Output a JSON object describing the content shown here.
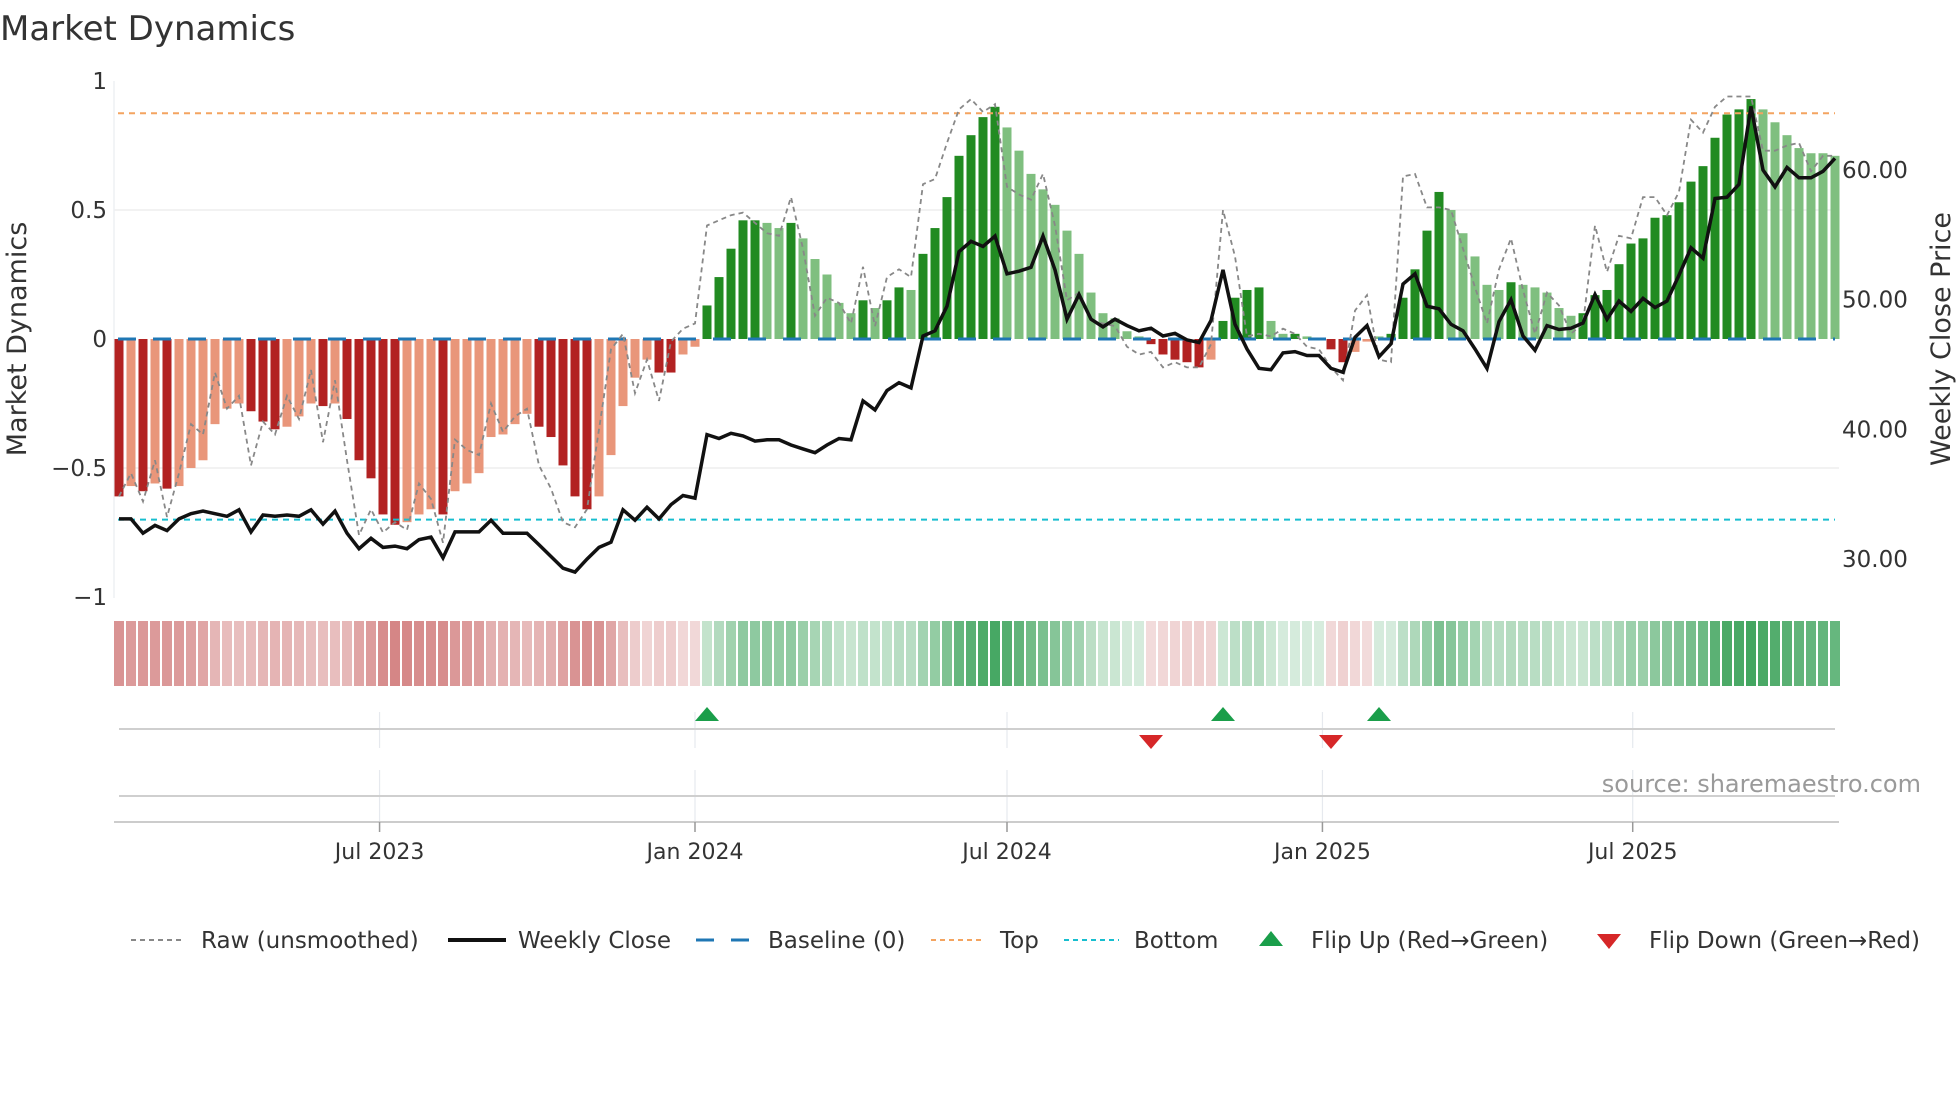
{
  "chart_data": {
    "type": "bar",
    "title": "Market Dynamics",
    "ylabel": "Market Dynamics",
    "y2label": "Weekly Close Price",
    "ylim": [
      -1,
      1
    ],
    "y2lim": [
      26,
      66
    ],
    "yticks": [
      {
        "value": 1,
        "label": "1"
      },
      {
        "value": 0.5,
        "label": "0.5"
      },
      {
        "value": 0,
        "label": "0"
      },
      {
        "value": -0.5,
        "label": "−0.5"
      },
      {
        "value": -1,
        "label": "−1"
      }
    ],
    "y2ticks": [
      {
        "value": 60,
        "label": "60.00"
      },
      {
        "value": 50,
        "label": "50.00"
      },
      {
        "value": 40,
        "label": "40.00"
      },
      {
        "value": 30,
        "label": "30.00"
      }
    ],
    "xticks": [
      {
        "date": "2023-07-01",
        "label": "Jul 2023"
      },
      {
        "date": "2024-01-01",
        "label": "Jan 2024"
      },
      {
        "date": "2024-07-01",
        "label": "Jul 2024"
      },
      {
        "date": "2025-01-01",
        "label": "Jan 2025"
      },
      {
        "date": "2025-07-01",
        "label": "Jul 2025"
      }
    ],
    "start_date": "2023-01-30",
    "frequency": "weekly",
    "grid": true,
    "legend_position": "bottom",
    "top_level": 0.875,
    "bottom_level": -0.7,
    "baseline": 0,
    "smoothed": [
      -0.61,
      -0.57,
      -0.59,
      -0.56,
      -0.58,
      -0.57,
      -0.5,
      -0.47,
      -0.33,
      -0.27,
      -0.25,
      -0.28,
      -0.32,
      -0.35,
      -0.34,
      -0.3,
      -0.25,
      -0.26,
      -0.25,
      -0.31,
      -0.47,
      -0.54,
      -0.68,
      -0.72,
      -0.71,
      -0.68,
      -0.66,
      -0.68,
      -0.59,
      -0.56,
      -0.52,
      -0.38,
      -0.37,
      -0.33,
      -0.29,
      -0.34,
      -0.38,
      -0.49,
      -0.61,
      -0.66,
      -0.61,
      -0.45,
      -0.26,
      -0.15,
      -0.08,
      -0.13,
      -0.13,
      -0.06,
      -0.03,
      0.13,
      0.24,
      0.35,
      0.46,
      0.46,
      0.45,
      0.43,
      0.45,
      0.39,
      0.31,
      0.25,
      0.14,
      0.1,
      0.15,
      0.12,
      0.15,
      0.2,
      0.19,
      0.33,
      0.43,
      0.55,
      0.71,
      0.79,
      0.86,
      0.9,
      0.82,
      0.73,
      0.64,
      0.58,
      0.52,
      0.42,
      0.33,
      0.18,
      0.1,
      0.08,
      0.03,
      0.01,
      -0.02,
      -0.06,
      -0.08,
      -0.09,
      -0.11,
      -0.08,
      0.07,
      0.16,
      0.19,
      0.2,
      0.07,
      0.02,
      0.02,
      0.01,
      0.005,
      -0.04,
      -0.09,
      -0.05,
      -0.01,
      0.01,
      0.02,
      0.16,
      0.27,
      0.42,
      0.57,
      0.5,
      0.41,
      0.32,
      0.21,
      0.19,
      0.22,
      0.21,
      0.2,
      0.18,
      0.12,
      0.09,
      0.1,
      0.17,
      0.19,
      0.29,
      0.37,
      0.39,
      0.47,
      0.48,
      0.53,
      0.61,
      0.67,
      0.78,
      0.87,
      0.89,
      0.93,
      0.89,
      0.84,
      0.79,
      0.74,
      0.72,
      0.72,
      0.71
    ],
    "strengthening": [
      1,
      0,
      1,
      0,
      1,
      0,
      0,
      0,
      0,
      0,
      0,
      1,
      1,
      1,
      0,
      0,
      0,
      1,
      0,
      1,
      1,
      1,
      1,
      1,
      0,
      0,
      0,
      1,
      0,
      0,
      0,
      0,
      0,
      0,
      0,
      1,
      1,
      1,
      1,
      1,
      0,
      0,
      0,
      0,
      0,
      1,
      1,
      0,
      0,
      1,
      1,
      1,
      1,
      1,
      0,
      0,
      1,
      0,
      0,
      0,
      0,
      0,
      1,
      0,
      1,
      1,
      0,
      1,
      1,
      1,
      1,
      1,
      1,
      1,
      0,
      0,
      0,
      0,
      0,
      0,
      0,
      0,
      0,
      0,
      0,
      0,
      1,
      1,
      1,
      1,
      1,
      0,
      1,
      1,
      1,
      1,
      0,
      0,
      1,
      0,
      0,
      1,
      1,
      0,
      0,
      0,
      1,
      1,
      1,
      1,
      1,
      0,
      0,
      0,
      0,
      0,
      1,
      0,
      0,
      0,
      0,
      0,
      1,
      1,
      1,
      1,
      1,
      1,
      1,
      1,
      1,
      1,
      1,
      1,
      1,
      1,
      1,
      0,
      0,
      0,
      0,
      0,
      0,
      0
    ],
    "raw": [
      -0.61,
      -0.52,
      -0.63,
      -0.47,
      -0.69,
      -0.52,
      -0.33,
      -0.37,
      -0.13,
      -0.27,
      -0.22,
      -0.49,
      -0.32,
      -0.37,
      -0.22,
      -0.31,
      -0.12,
      -0.4,
      -0.16,
      -0.47,
      -0.76,
      -0.66,
      -0.75,
      -0.71,
      -0.74,
      -0.56,
      -0.62,
      -0.79,
      -0.39,
      -0.43,
      -0.45,
      -0.25,
      -0.36,
      -0.3,
      -0.27,
      -0.49,
      -0.58,
      -0.71,
      -0.73,
      -0.66,
      -0.35,
      -0.04,
      0.02,
      -0.21,
      -0.08,
      -0.24,
      -0.01,
      0.04,
      0.06,
      0.44,
      0.46,
      0.48,
      0.49,
      0.45,
      0.41,
      0.4,
      0.55,
      0.35,
      0.09,
      0.16,
      0.14,
      0.06,
      0.28,
      0.05,
      0.24,
      0.27,
      0.24,
      0.6,
      0.62,
      0.76,
      0.89,
      0.93,
      0.88,
      0.91,
      0.59,
      0.56,
      0.54,
      0.64,
      0.44,
      0.15,
      0.18,
      0.07,
      0.06,
      0.05,
      -0.03,
      -0.06,
      -0.05,
      -0.11,
      -0.09,
      -0.11,
      -0.11,
      -0.02,
      0.5,
      0.32,
      0.01,
      0.02,
      0.01,
      0.04,
      0.02,
      -0.03,
      -0.04,
      -0.11,
      -0.16,
      0.11,
      0.17,
      -0.08,
      -0.09,
      0.63,
      0.64,
      0.51,
      0.51,
      0.5,
      0.35,
      0.2,
      0.06,
      0.27,
      0.39,
      0.19,
      0.02,
      0.18,
      0.13,
      0.02,
      0.06,
      0.44,
      0.26,
      0.4,
      0.39,
      0.55,
      0.55,
      0.48,
      0.57,
      0.85,
      0.8,
      0.9,
      0.94,
      0.94,
      0.94,
      0.73,
      0.73,
      0.75,
      0.76,
      0.65,
      0.71,
      0.71
    ],
    "weekly_close": [
      33.1,
      33.1,
      32.0,
      32.6,
      32.2,
      33.1,
      33.5,
      33.7,
      33.5,
      33.3,
      33.8,
      32.1,
      33.4,
      33.3,
      33.4,
      33.3,
      33.8,
      32.7,
      33.7,
      32.0,
      30.8,
      31.6,
      30.9,
      31.0,
      30.8,
      31.5,
      31.7,
      30.1,
      32.1,
      32.1,
      32.1,
      33.0,
      32.0,
      32.0,
      32.0,
      31.1,
      30.2,
      29.3,
      29.0,
      30.0,
      30.9,
      31.3,
      33.8,
      33.0,
      34.0,
      33.1,
      34.2,
      34.9,
      34.7,
      39.6,
      39.3,
      39.7,
      39.5,
      39.1,
      39.2,
      39.2,
      38.8,
      38.5,
      38.2,
      38.8,
      39.3,
      39.2,
      42.2,
      41.5,
      43.0,
      43.6,
      43.2,
      47.2,
      47.6,
      49.5,
      53.7,
      54.5,
      54.1,
      54.9,
      52.0,
      52.2,
      52.5,
      54.9,
      52.3,
      48.5,
      50.4,
      48.5,
      47.9,
      48.5,
      48.0,
      47.6,
      47.8,
      47.2,
      47.4,
      46.9,
      46.7,
      48.4,
      52.3,
      48.1,
      46.2,
      44.7,
      44.6,
      45.9,
      46.0,
      45.7,
      45.7,
      44.7,
      44.4,
      47.1,
      48.0,
      45.6,
      46.6,
      51.2,
      52.0,
      49.5,
      49.3,
      48.1,
      47.6,
      46.2,
      44.7,
      48.3,
      50.0,
      47.2,
      46.1,
      48.0,
      47.7,
      47.8,
      48.2,
      50.4,
      48.5,
      49.9,
      49.1,
      50.1,
      49.4,
      49.9,
      51.9,
      54.0,
      53.2,
      57.8,
      57.9,
      58.9,
      64.9,
      60.0,
      58.7,
      60.2,
      59.4,
      59.4,
      59.9,
      60.9
    ],
    "flip_up_weeks": [
      50,
      93,
      106
    ],
    "flip_down_weeks": [
      87,
      102
    ],
    "legend": [
      {
        "key": "raw",
        "label": "Raw (unsmoothed)"
      },
      {
        "key": "close",
        "label": "Weekly Close"
      },
      {
        "key": "baseline",
        "label": "Baseline (0)"
      },
      {
        "key": "top",
        "label": "Top"
      },
      {
        "key": "bottom",
        "label": "Bottom"
      },
      {
        "key": "flip_up",
        "label": "Flip Up (Red→Green)"
      },
      {
        "key": "flip_down",
        "label": "Flip Down (Green→Red)"
      }
    ],
    "colors": {
      "green_strong": "#228b22",
      "green_weak": "#7fbf7f",
      "red_strong": "#b22222",
      "red_weak": "#e9967a",
      "raw": "#888888",
      "close": "#111111",
      "baseline": "#1f77b4",
      "top": "#f4a460",
      "bottom": "#17becf",
      "flip_up": "#1a9e4a",
      "flip_down": "#d62728"
    }
  },
  "source": "source: sharemaestro.com"
}
